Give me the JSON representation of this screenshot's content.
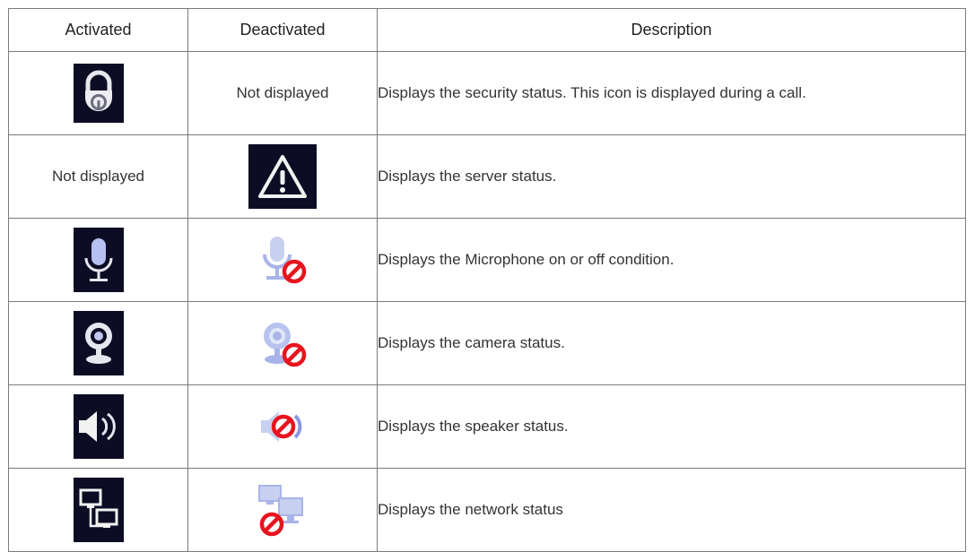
{
  "headers": {
    "activated": "Activated",
    "deactivated": "Deactivated",
    "description": "Description"
  },
  "rows": [
    {
      "activated": {
        "icon": "padlock-icon"
      },
      "deactivated": {
        "text": "Not displayed"
      },
      "description": "Displays the security status. This icon is displayed during a call."
    },
    {
      "activated": {
        "text": "Not displayed"
      },
      "deactivated": {
        "icon": "warning-triangle-icon"
      },
      "description": "Displays the server status."
    },
    {
      "activated": {
        "icon": "microphone-icon"
      },
      "deactivated": {
        "icon": "microphone-off-icon"
      },
      "description": "Displays the Microphone on or off condition."
    },
    {
      "activated": {
        "icon": "camera-icon"
      },
      "deactivated": {
        "icon": "camera-off-icon"
      },
      "description": "Displays the camera status."
    },
    {
      "activated": {
        "icon": "speaker-icon"
      },
      "deactivated": {
        "icon": "speaker-off-icon"
      },
      "description": "Displays the speaker status."
    },
    {
      "activated": {
        "icon": "network-icon"
      },
      "deactivated": {
        "icon": "network-off-icon"
      },
      "description": "Displays the network status"
    }
  ],
  "colors": {
    "icon_bg": "#0c0c24",
    "prohibit_red": "#e8141e",
    "disabled_blue": "#a8b4e8"
  }
}
